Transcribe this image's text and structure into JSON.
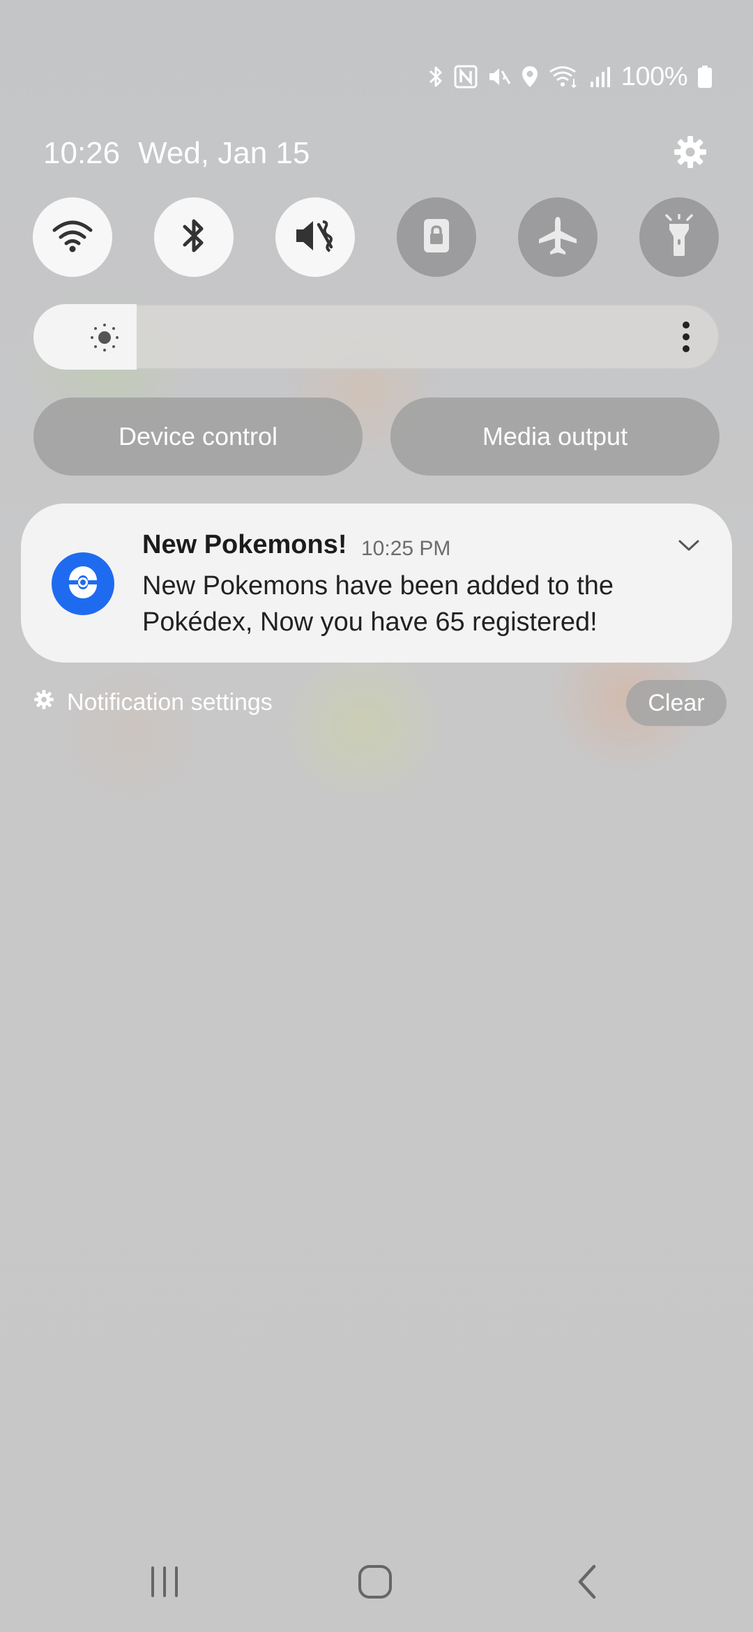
{
  "status_bar": {
    "icons": [
      "bluetooth-icon",
      "nfc-icon",
      "mute-icon",
      "location-icon",
      "wifi-icon",
      "signal-icon",
      "battery-icon"
    ],
    "battery_percent": "100%"
  },
  "header": {
    "time": "10:26",
    "date": "Wed, Jan 15"
  },
  "quick_toggles": [
    {
      "name": "wifi",
      "icon": "wifi-icon",
      "state": "on"
    },
    {
      "name": "bluetooth",
      "icon": "bluetooth-icon",
      "state": "on"
    },
    {
      "name": "sound-mute",
      "icon": "mute-icon",
      "state": "on"
    },
    {
      "name": "screen-lock",
      "icon": "lock-icon",
      "state": "off"
    },
    {
      "name": "airplane-mode",
      "icon": "airplane-icon",
      "state": "off"
    },
    {
      "name": "flashlight",
      "icon": "flashlight-icon",
      "state": "off"
    }
  ],
  "brightness": {
    "level": 0.15
  },
  "controls": {
    "device_control": "Device control",
    "media_output": "Media output"
  },
  "notification": {
    "title": "New Pokemons!",
    "time": "10:25 PM",
    "body": "New Pokemons have been added to the Pokédex, Now you have 65 registered!",
    "icon": "pokeball-icon",
    "accent": "#1f6bf0"
  },
  "footer": {
    "settings_label": "Notification settings",
    "clear_label": "Clear"
  },
  "nav": [
    "recents-icon",
    "home-icon",
    "back-icon"
  ]
}
